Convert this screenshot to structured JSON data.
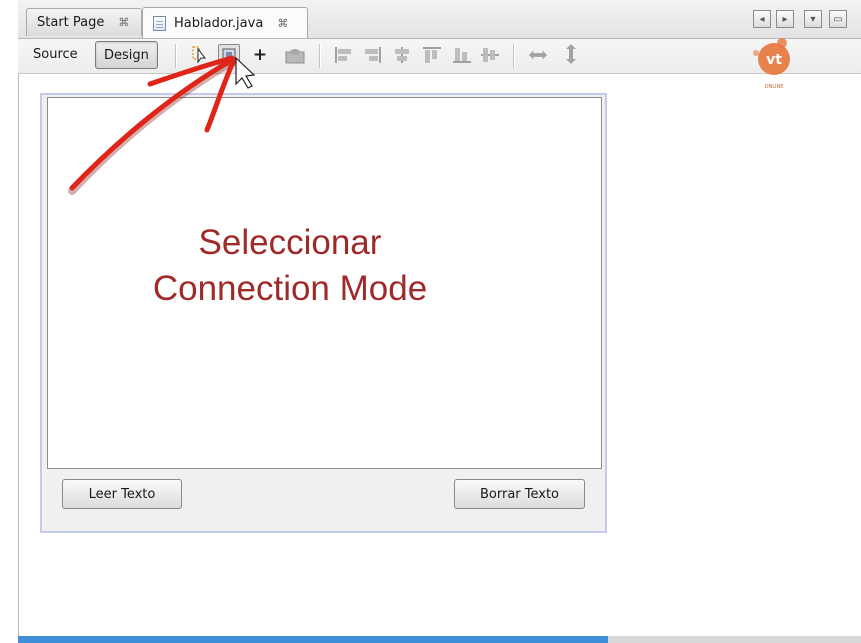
{
  "tabs": [
    {
      "label": "Start Page",
      "close": "⌘",
      "active": false
    },
    {
      "label": "Hablador.java",
      "close": "⌘",
      "active": true
    }
  ],
  "window_controls": [
    "◂",
    "▸",
    "▾",
    "▭"
  ],
  "toolbar": {
    "source_label": "Source",
    "design_label": "Design",
    "plus_label": "+"
  },
  "form": {
    "left_button": "Leer Texto",
    "right_button": "Borrar Texto"
  },
  "annotation": {
    "line1": "Seleccionar",
    "line2": "Connection Mode"
  },
  "logo": {
    "text": "vt",
    "subtext": "ONLINE",
    "color": "#e8743b"
  },
  "colors": {
    "annotation": "#9e2a2a",
    "arrow": "#e02418",
    "progress": "#3f8ed8"
  },
  "progress": {
    "fraction": 0.7
  }
}
